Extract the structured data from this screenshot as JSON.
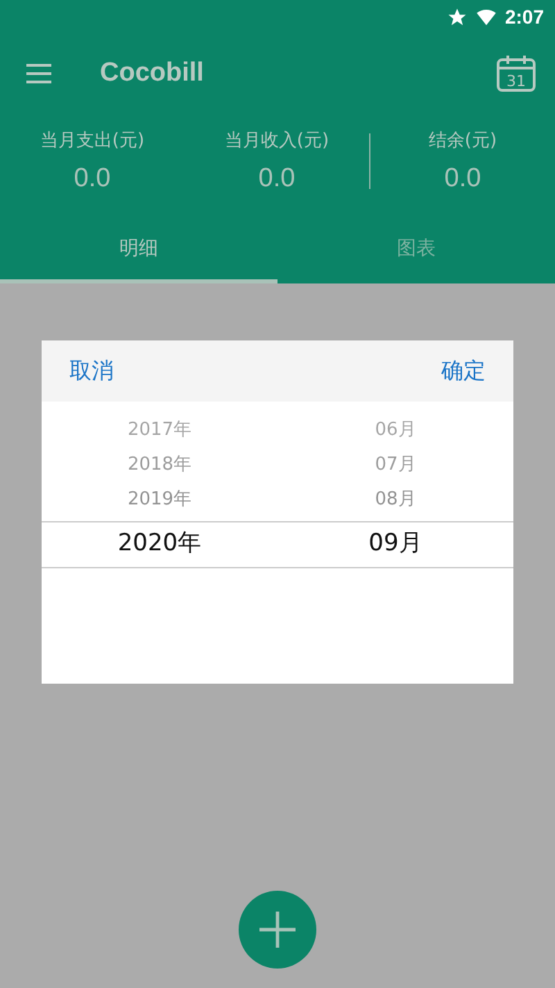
{
  "status_bar": {
    "time": "2:07"
  },
  "toolbar": {
    "title": "Cocobill",
    "calendar_day": "31"
  },
  "summary": [
    {
      "label": "当月支出(元)",
      "value": "0.0"
    },
    {
      "label": "当月收入(元)",
      "value": "0.0"
    },
    {
      "label": "结余(元)",
      "value": "0.0"
    }
  ],
  "tabs": [
    {
      "label": "明细",
      "selected": true
    },
    {
      "label": "图表",
      "selected": false
    }
  ],
  "picker": {
    "cancel": "取消",
    "confirm": "确定",
    "wheels": [
      {
        "items": [
          {
            "text": "2017年",
            "selected": false
          },
          {
            "text": "2018年",
            "selected": false
          },
          {
            "text": "2019年",
            "selected": false
          },
          {
            "text": "2020年",
            "selected": true
          }
        ]
      },
      {
        "items": [
          {
            "text": "06月",
            "selected": false
          },
          {
            "text": "07月",
            "selected": false
          },
          {
            "text": "08月",
            "selected": false
          },
          {
            "text": "09月",
            "selected": true
          }
        ]
      }
    ]
  }
}
